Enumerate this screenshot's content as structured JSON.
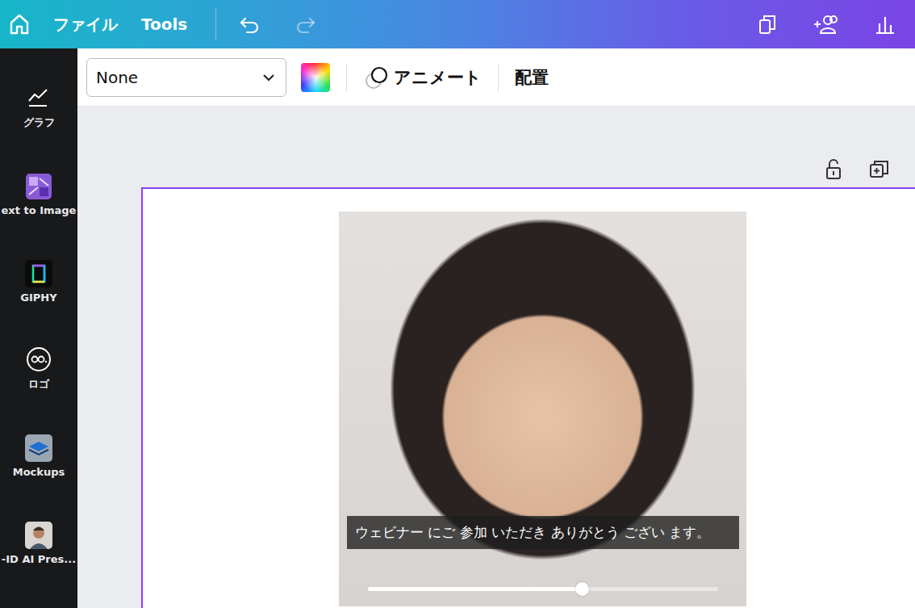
{
  "top_bar": {
    "menu": [
      {
        "label": "ファイル"
      },
      {
        "label": "Tools"
      }
    ],
    "history": [
      {
        "kind": "undo",
        "disabled": false
      },
      {
        "kind": "redo",
        "disabled": true
      }
    ]
  },
  "toolbar": {
    "font_dropdown": "None",
    "animate": "アニメート",
    "arrange": "配置"
  },
  "sidebar": {
    "items": [
      {
        "label": "グラフ"
      },
      {
        "label": "ext to Image"
      },
      {
        "label": "GIPHY"
      },
      {
        "label": "ロゴ"
      },
      {
        "label": "Mockups"
      },
      {
        "label": "-ID AI Pres..."
      }
    ]
  },
  "video": {
    "caption": "ウェビナー にご 参加 いただき ありがとう ござい ます。",
    "progress": {
      "level": 0.61
    }
  }
}
